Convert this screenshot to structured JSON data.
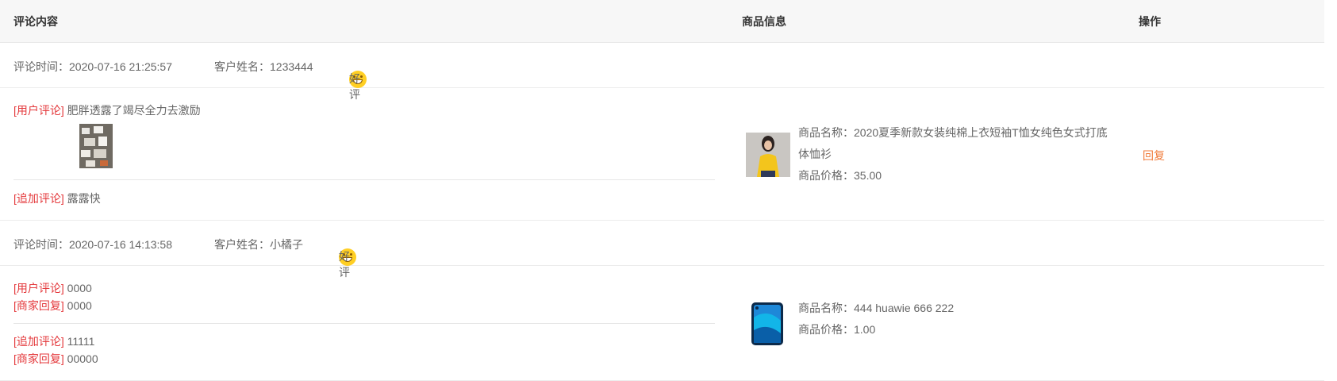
{
  "header": {
    "content": "评论内容",
    "product": "商品信息",
    "operation": "操作"
  },
  "reviews": [
    {
      "time_label": "评论时间：2020-07-16 21:25:57",
      "customer_label": "客户姓名：1233444",
      "rating": "好评",
      "user_comment_tag": "[用户评论]",
      "user_comment": "肥胖透露了竭尽全力去激励",
      "append_tag": "[追加评论]",
      "append_comment": "露露快",
      "product_name": "商品名称：2020夏季新款女装纯棉上衣短袖T恤女纯色女式打底体恤衫",
      "product_price": "商品价格：35.00",
      "reply": "回复"
    },
    {
      "time_label": "评论时间：2020-07-16 14:13:58",
      "customer_label": "客户姓名：小橘子",
      "rating": "好评",
      "user_comment_tag": "[用户评论]",
      "user_comment": "0000",
      "merchant_reply_tag": "[商家回复]",
      "merchant_reply": "0000",
      "append_tag": "[追加评论]",
      "append_comment": "11111",
      "append_reply_tag": "[商家回复]",
      "append_reply": "00000",
      "product_name": "商品名称：444 huawie 666 222",
      "product_price": "商品价格：1.00"
    }
  ],
  "colors": {
    "tag_red": "#e4393c",
    "rating_yellow": "#f5b400",
    "reply_orange": "#f07a38"
  },
  "icons": {
    "rating": "laughing-face-icon"
  }
}
